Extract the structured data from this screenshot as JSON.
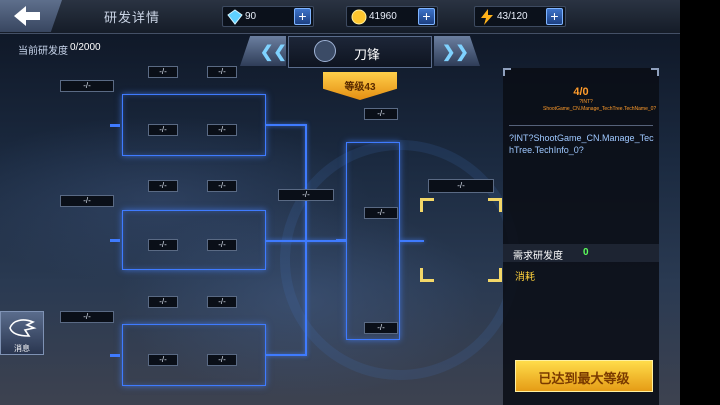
{
  "header": {
    "title": "研发详情",
    "back_icon": "back-arrow-icon"
  },
  "resources": [
    {
      "icon": "diamond-icon",
      "value": "90",
      "plus": "+"
    },
    {
      "icon": "gold-coin-icon",
      "value": "41960",
      "plus": "+"
    },
    {
      "icon": "energy-bolt-icon",
      "value": "43/120",
      "plus": "+"
    }
  ],
  "progress": {
    "label": "当前研发度",
    "value": "0/2000"
  },
  "selector": {
    "prev_icon": "double-chevron-left-icon",
    "next_icon": "double-chevron-right-icon",
    "name": "刀锋",
    "level": "等级43"
  },
  "tree": {
    "placeholder": "-/-",
    "nodes": [
      "-/-",
      "-/-",
      "-/-",
      "-/-",
      "-/-",
      "-/-",
      "-/-",
      "-/-",
      "-/-",
      "-/-",
      "-/-",
      "-/-",
      "-/-",
      "-/-",
      "-/-",
      "-/-",
      "-/-",
      "-/-",
      "-/-",
      "-/-",
      "-/-",
      "-/-",
      "-/-",
      "-/-",
      "-/-",
      "-/-"
    ]
  },
  "panel": {
    "count": "4/0",
    "name": "?INT?ShootGame_CN.Manage_TechTree.TechName_0?",
    "info": "?INT?ShootGame_CN.Manage_TechTree.TechInfo_0?",
    "req_label": "需求研发度",
    "req_value": "0",
    "cost_label": "消耗",
    "max_button": "已达到最大等级"
  },
  "message": {
    "label": "消息",
    "icon": "message-icon"
  }
}
